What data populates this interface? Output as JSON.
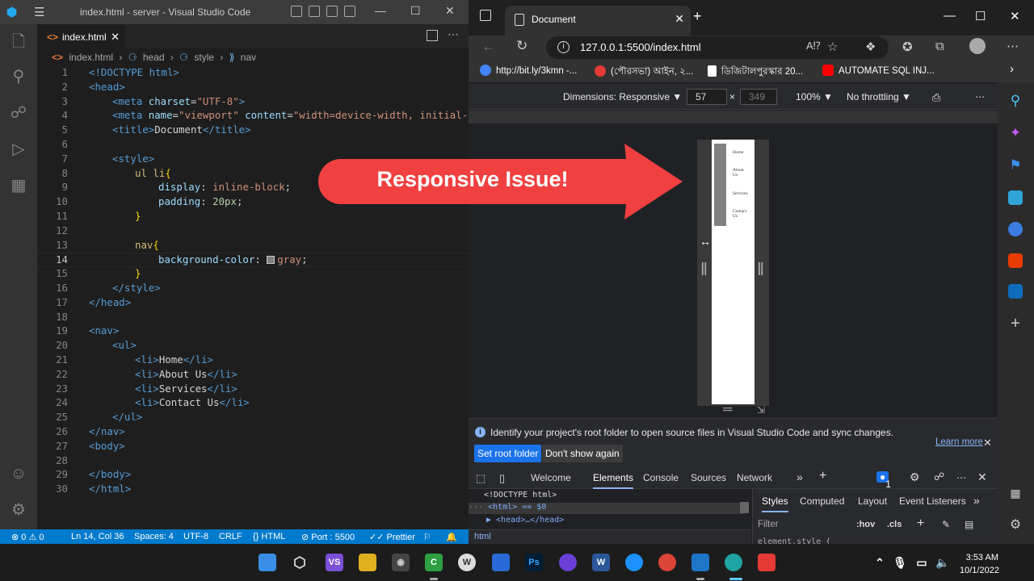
{
  "vscode": {
    "window_title": "index.html - server - Visual Studio Code",
    "tab_label": "index.html",
    "tab_icon": "<>",
    "breadcrumb": [
      "index.html",
      "head",
      "style",
      "nav"
    ],
    "lines": [
      {
        "n": "1"
      },
      {
        "n": "2"
      },
      {
        "n": "3"
      },
      {
        "n": "4"
      },
      {
        "n": "5"
      },
      {
        "n": "6"
      },
      {
        "n": "7"
      },
      {
        "n": "8"
      },
      {
        "n": "9"
      },
      {
        "n": "10"
      },
      {
        "n": "11"
      },
      {
        "n": "12"
      },
      {
        "n": "13"
      },
      {
        "n": "14"
      },
      {
        "n": "15"
      },
      {
        "n": "16"
      },
      {
        "n": "17"
      },
      {
        "n": "18"
      },
      {
        "n": "19"
      },
      {
        "n": "20"
      },
      {
        "n": "21"
      },
      {
        "n": "22"
      },
      {
        "n": "23"
      },
      {
        "n": "24"
      },
      {
        "n": "25"
      },
      {
        "n": "26"
      },
      {
        "n": "27"
      },
      {
        "n": "28"
      },
      {
        "n": "29"
      },
      {
        "n": "30"
      }
    ],
    "code": {
      "doctype": "<!DOCTYPE html>",
      "head_open": "<head>",
      "meta_charset_attr": "charset",
      "meta_charset_val": "\"UTF-8\"",
      "meta_name_attr": "name",
      "meta_name_val": "\"viewport\"",
      "meta_content_attr": "content",
      "meta_content_val": "\"width=device-width, initial-sc",
      "title_text": "Document",
      "style_open": "<style>",
      "sel_ul_li": "ul li",
      "prop_display": "display",
      "val_display": "inline-block",
      "prop_padding": "padding",
      "val_padding": "20px",
      "sel_nav": "nav",
      "prop_bg": "background-color",
      "val_bg": "gray",
      "style_close": "</style>",
      "head_close": "</head>",
      "nav_open": "<nav>",
      "ul_open": "<ul>",
      "li_items": [
        "Home",
        "About Us",
        "Services",
        "Contact Us"
      ],
      "ul_close": "</ul>",
      "nav_close": "</nav>",
      "body_open": "<body>",
      "body_close": "</body>",
      "html_close": "</html>"
    },
    "status": {
      "errors": "⊗ 0 ⚠ 0",
      "position": "Ln 14, Col 36",
      "spaces": "Spaces: 4",
      "encoding": "UTF-8",
      "eol": "CRLF",
      "language": "{} HTML",
      "port": "⊘ Port : 5500",
      "prettier": "✓✓ Prettier"
    }
  },
  "browser": {
    "tab_title": "Document",
    "url": "127.0.0.1:5500/index.html",
    "bookmarks": [
      {
        "label": "http://bit.ly/3kmn -...",
        "color": "#4285f4"
      },
      {
        "label": "(পৌরসভা) আইন, ২...",
        "color": "#e53935"
      },
      {
        "label": "ডিজিটালপুরস্কার 20...",
        "color": "#ffffff"
      },
      {
        "label": "AUTOMATE SQL INJ...",
        "color": "#ff0000"
      }
    ],
    "devtools_toolbar": {
      "dimensions": "Dimensions: Responsive ▼",
      "width": "57",
      "times": "×",
      "height": "349",
      "zoom": "100% ▼",
      "throttling": "No throttling ▼"
    },
    "device_nav_items": [
      "Home",
      "About Us",
      "Services",
      "Contact Us"
    ],
    "infobar": {
      "message": "Identify your project's root folder to open source files in Visual Studio Code and sync changes.",
      "learn_more": "Learn more",
      "set_root": "Set root folder",
      "dont_show": "Don't show again"
    },
    "devtools_tabs": [
      "Welcome",
      "Elements",
      "Console",
      "Sources",
      "Network"
    ],
    "issues_count": "1",
    "dom": {
      "doctype": "<!DOCTYPE html>",
      "html_line": "<html> == $0",
      "head_line": "▶ <head>…</head>"
    },
    "styles_tabs": [
      "Styles",
      "Computed",
      "Layout",
      "Event Listeners"
    ],
    "filter_placeholder": "Filter",
    "hov": ":hov",
    "cls": ".cls",
    "element_style": "element.style {",
    "crumb": "html"
  },
  "overlay": {
    "text": "Responsive Issue!",
    "color": "#f04040"
  },
  "taskbar": {
    "time": "3:53 AM",
    "date": "10/1/2022"
  }
}
